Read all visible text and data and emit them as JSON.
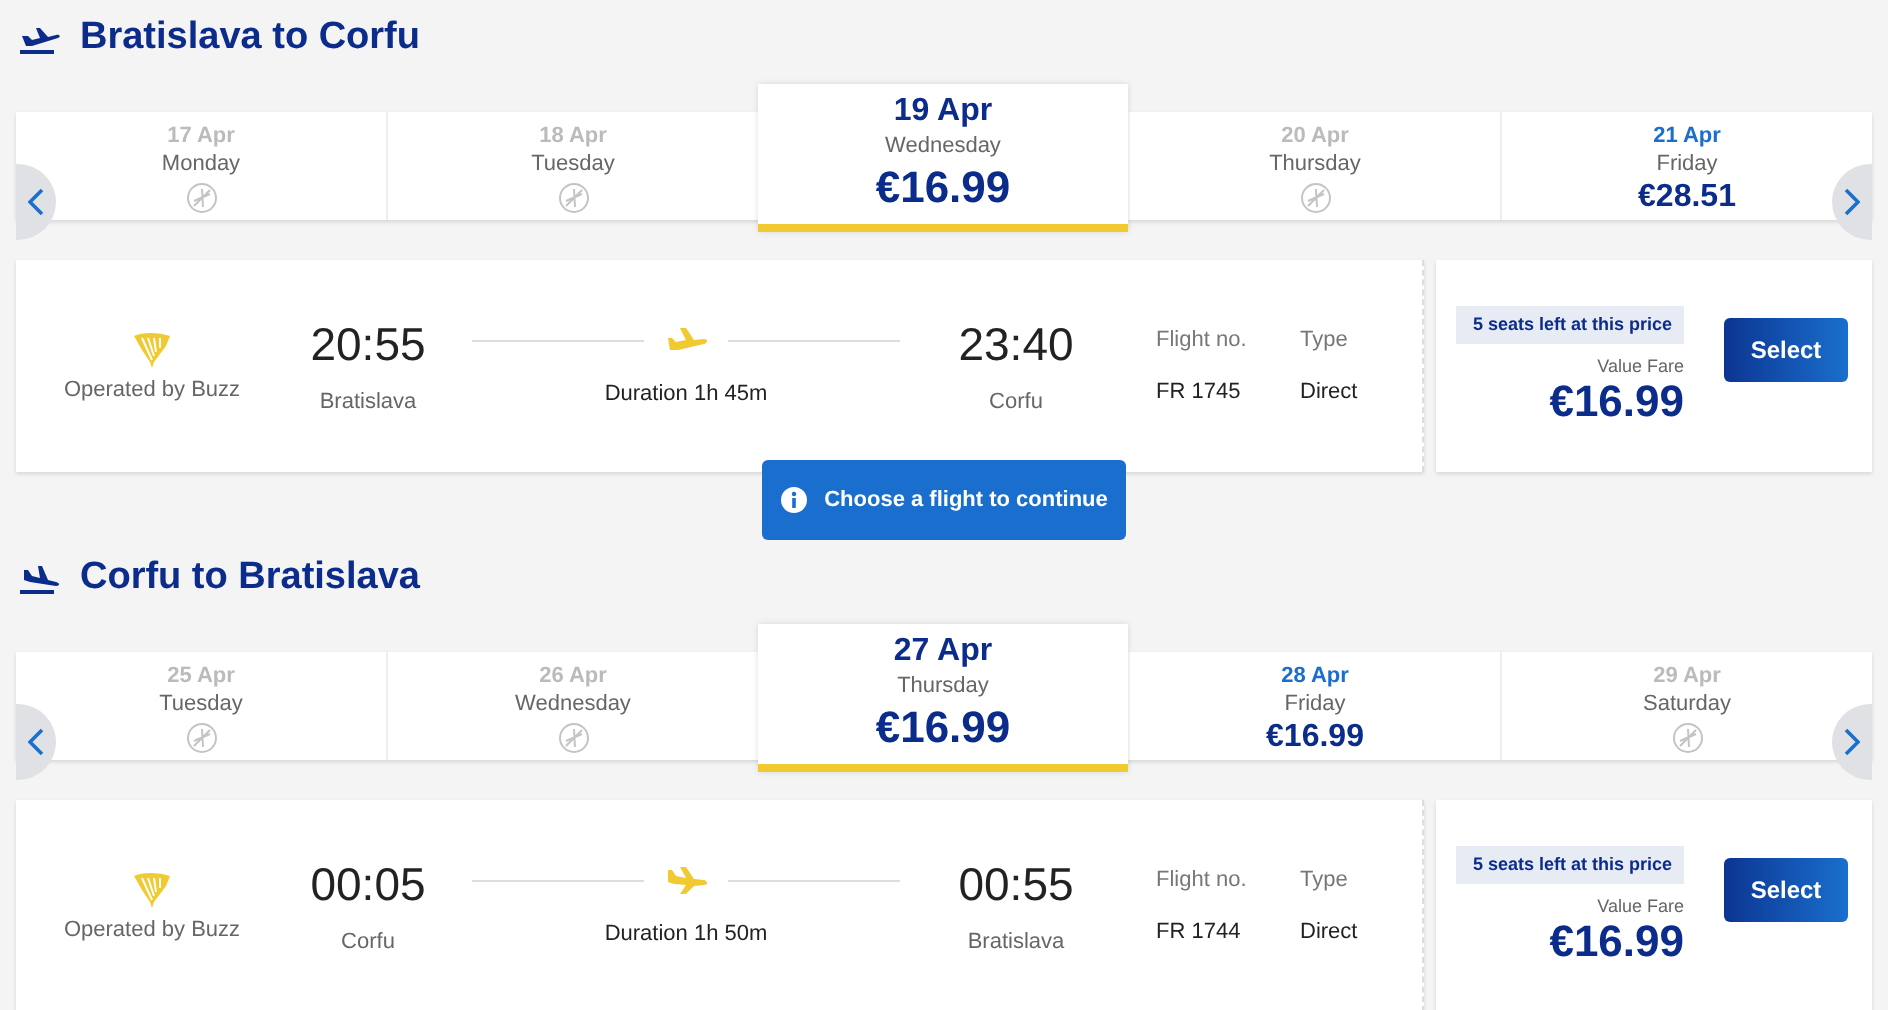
{
  "legs": [
    {
      "title": "Bratislava to Corfu",
      "kind": "outbound",
      "days": [
        {
          "date": "17 Apr",
          "weekday": "Monday",
          "kind": "no-flights",
          "selected": false
        },
        {
          "date": "18 Apr",
          "weekday": "Tuesday",
          "kind": "no-flights",
          "selected": false
        },
        {
          "date": "19 Apr",
          "weekday": "Wednesday",
          "kind": "fare",
          "price": "€16.99",
          "selected": true
        },
        {
          "date": "20 Apr",
          "weekday": "Thursday",
          "kind": "no-flights",
          "selected": false
        },
        {
          "date": "21 Apr",
          "weekday": "Friday",
          "kind": "fare",
          "price": "€28.51",
          "selected": false
        }
      ],
      "flight": {
        "operator": "Operated by Buzz",
        "departure_time": "20:55",
        "departure_city": "Bratislava",
        "duration": "Duration 1h 45m",
        "arrival_time": "23:40",
        "arrival_city": "Corfu",
        "flight_no_label": "Flight no.",
        "flight_no": "FR 1745",
        "type_label": "Type",
        "type": "Direct",
        "seats_notice": "5 seats left at this price",
        "fare_name": "Value Fare",
        "price": "€16.99",
        "button": "Select"
      },
      "tooltip": "Choose a flight to continue"
    },
    {
      "title": "Corfu to Bratislava",
      "kind": "return",
      "days": [
        {
          "date": "25 Apr",
          "weekday": "Tuesday",
          "kind": "no-flights",
          "selected": false
        },
        {
          "date": "26 Apr",
          "weekday": "Wednesday",
          "kind": "no-flights",
          "selected": false
        },
        {
          "date": "27 Apr",
          "weekday": "Thursday",
          "kind": "fare",
          "price": "€16.99",
          "selected": true
        },
        {
          "date": "28 Apr",
          "weekday": "Friday",
          "kind": "fare",
          "price": "€16.99",
          "selected": false
        },
        {
          "date": "29 Apr",
          "weekday": "Saturday",
          "kind": "no-flights",
          "selected": false
        }
      ],
      "flight": {
        "operator": "Operated by Buzz",
        "departure_time": "00:05",
        "departure_city": "Corfu",
        "duration": "Duration 1h 50m",
        "arrival_time": "00:55",
        "arrival_city": "Bratislava",
        "flight_no_label": "Flight no.",
        "flight_no": "FR 1744",
        "type_label": "Type",
        "type": "Direct",
        "seats_notice": "5 seats left at this price",
        "fare_name": "Value Fare",
        "price": "€16.99",
        "button": "Select"
      }
    }
  ]
}
